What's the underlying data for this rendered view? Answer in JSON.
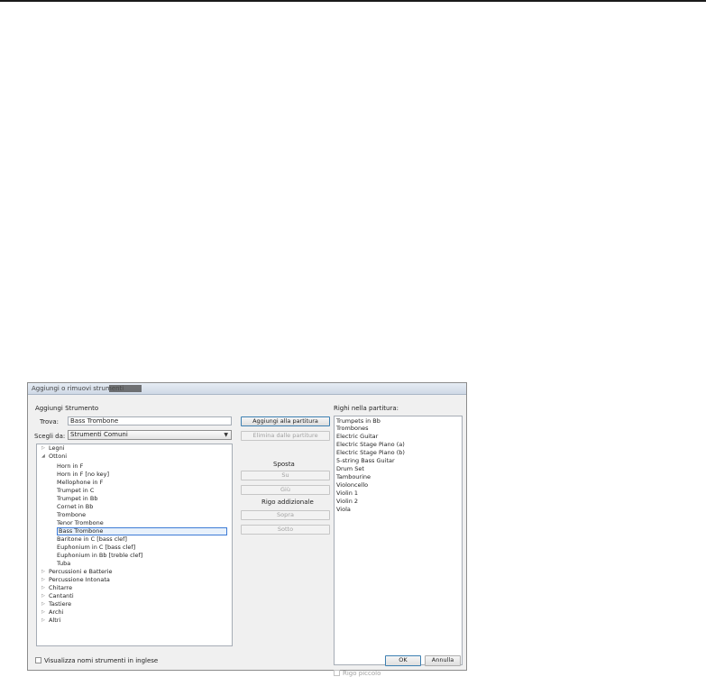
{
  "window": {
    "title": "Aggiungi o rimuovi strumenti"
  },
  "left": {
    "section_title": "Aggiungi Strumento",
    "find_label": "Trova:",
    "find_value": "Bass Trombone",
    "choose_label": "Scegli da:",
    "choose_value": "Strumenti Comuni"
  },
  "tree": {
    "categories_before": [
      {
        "label": "Legni",
        "expanded": false
      }
    ],
    "expanded": {
      "label": "Ottoni",
      "expanded": true
    },
    "children": [
      "Horn in F",
      "Horn in F [no key]",
      "Mellophone in F",
      "Trumpet in C",
      "Trumpet in Bb",
      "Cornet in Bb",
      "Trombone",
      "Tenor Trombone",
      "Bass Trombone",
      "Baritone in C [bass clef]",
      "Euphonium in C [bass clef]",
      "Euphonium in Bb [treble clef]",
      "Tuba"
    ],
    "selected_child": "Bass Trombone",
    "categories_after": [
      "Percussioni e Batterie",
      "Percussione Intonata",
      "Chitarre",
      "Cantanti",
      "Tastiere",
      "Archi",
      "Altri"
    ]
  },
  "middle": {
    "add_button": "Aggiungi alla partitura",
    "remove_button": "Elimina dalle partiture",
    "move_label": "Sposta",
    "up_button": "Su",
    "down_button": "Giù",
    "extra_staff_label": "Rigo addizionale",
    "above_button": "Sopra",
    "below_button": "Sotto"
  },
  "right": {
    "title": "Righi nella partitura:",
    "staves": [
      "Trumpets in Bb",
      "Trombones",
      "Electric Guitar",
      "Electric Stage Piano (a)",
      "Electric Stage Piano (b)",
      "5-string Bass Guitar",
      "Drum Set",
      "Tambourine",
      "Violoncello",
      "Violin 1",
      "Violin 2",
      "Viola"
    ],
    "small_staff_label": "Rigo piccolo"
  },
  "footer": {
    "english_names_label": "Visualizza nomi strumenti in inglese",
    "ok_button": "OK",
    "cancel_button": "Annulla"
  },
  "icons": {
    "collapsed": "triangle-right-icon",
    "expanded": "triangle-down-icon",
    "dropdown": "chevron-down-icon"
  }
}
